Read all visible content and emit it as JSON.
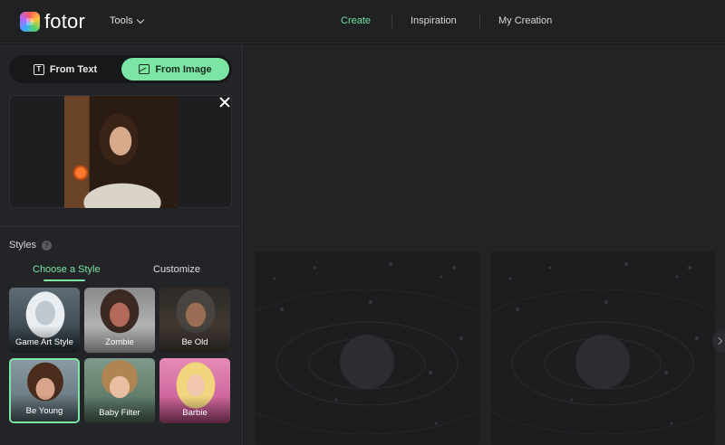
{
  "header": {
    "brand": "fotor",
    "tools_label": "Tools",
    "nav": [
      "Create",
      "Inspiration",
      "My Creation"
    ],
    "active_nav": "Create",
    "accent_color": "#6ee2a5"
  },
  "sidebar": {
    "mode_tabs": [
      {
        "label": "From Text",
        "icon": "text-icon",
        "active": false
      },
      {
        "label": "From Image",
        "icon": "image-icon",
        "active": true
      }
    ],
    "upload": {
      "icon_close": "close-icon"
    },
    "styles_label": "Styles",
    "style_tabs": [
      {
        "label": "Choose a Style",
        "active": true
      },
      {
        "label": "Customize",
        "active": false
      }
    ],
    "styles": [
      {
        "label": "Game Art Style",
        "selected": false
      },
      {
        "label": "Zombie",
        "selected": false
      },
      {
        "label": "Be Old",
        "selected": false
      },
      {
        "label": "Be Young",
        "selected": true
      },
      {
        "label": "Baby Filter",
        "selected": false
      },
      {
        "label": "Barbie",
        "selected": false
      }
    ]
  },
  "canvas": {
    "previews": [
      "placeholder-planet-image",
      "placeholder-planet-image"
    ]
  }
}
